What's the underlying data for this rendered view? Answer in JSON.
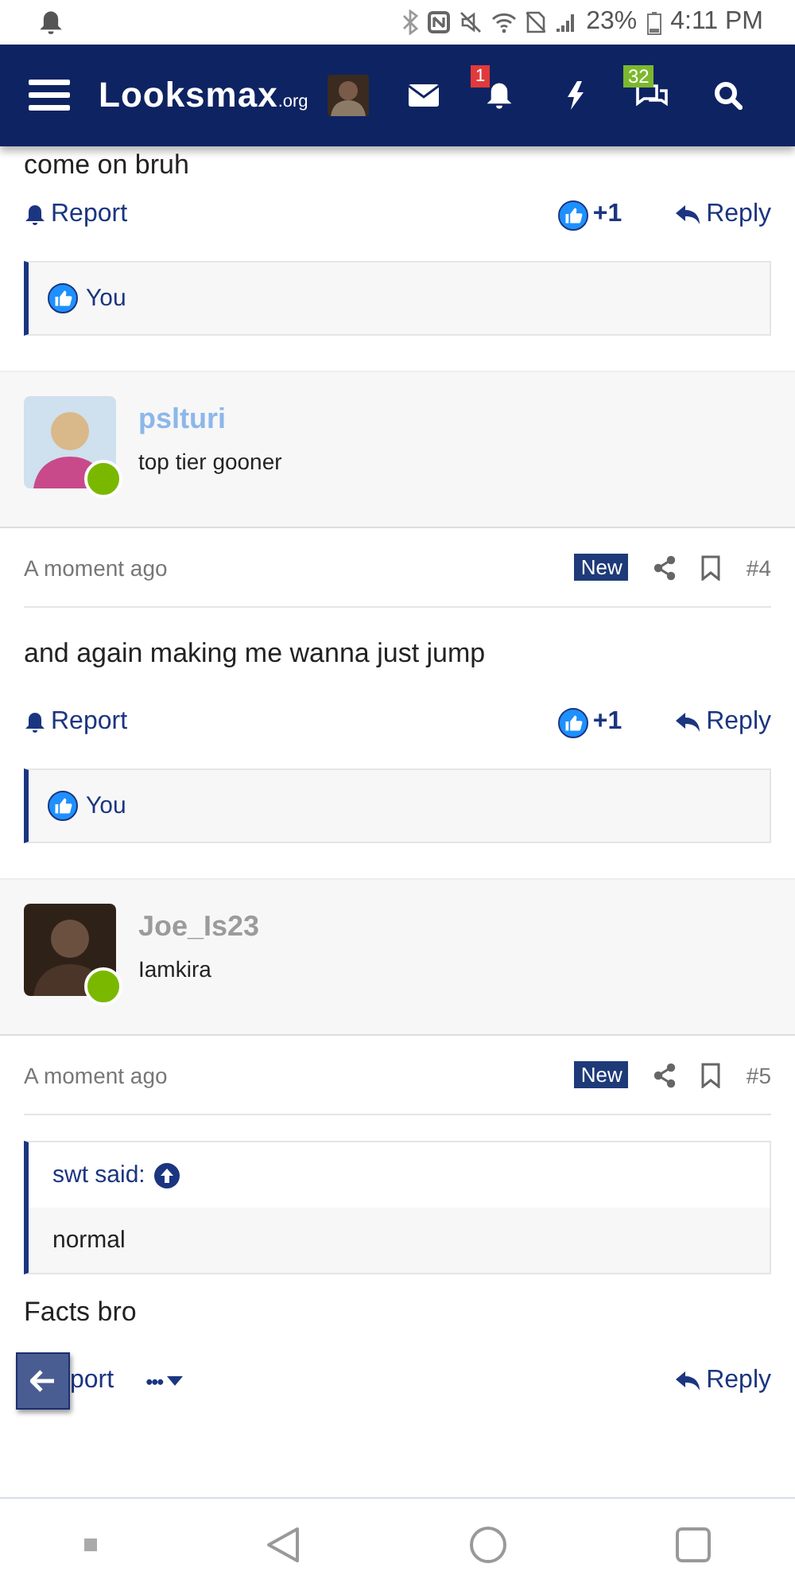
{
  "status_bar": {
    "battery": "23%",
    "time": "4:11 PM"
  },
  "header": {
    "logo": "Looksmax",
    "logo_suffix": ".org",
    "alerts_badge": "1",
    "conversations_badge": "32"
  },
  "posts": [
    {
      "kind": "tail",
      "body": "come on bruh",
      "actions": {
        "report": "Report",
        "like_count": "+1",
        "reply": "Reply"
      },
      "reactions": "You"
    },
    {
      "kind": "full",
      "user": {
        "name": "pslturi",
        "color": "#8cb7ea",
        "title": "top tier gooner"
      },
      "time": "A moment ago",
      "badge": "New",
      "number": "#4",
      "body": "and again making me wanna just jump",
      "actions": {
        "report": "Report",
        "like_count": "+1",
        "reply": "Reply"
      },
      "reactions": "You"
    },
    {
      "kind": "full",
      "user": {
        "name": "Joe_Is23",
        "color": "#9b9b9b",
        "title": "Iamkira"
      },
      "time": "A moment ago",
      "badge": "New",
      "number": "#5",
      "quote": {
        "author": "swt said:",
        "text": "normal"
      },
      "body": "Facts bro",
      "actions": {
        "report": "port",
        "more": "•••",
        "reply": "Reply"
      }
    }
  ]
}
